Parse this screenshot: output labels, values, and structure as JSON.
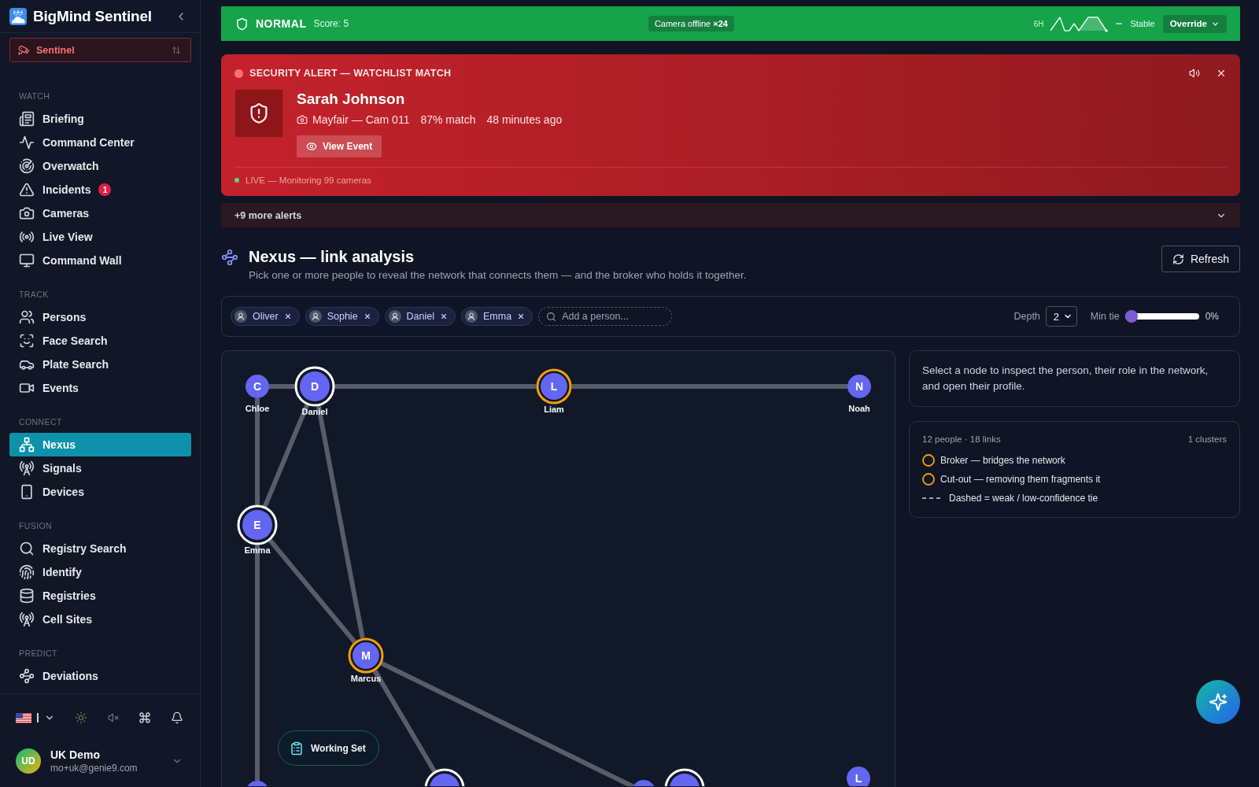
{
  "sidebar": {
    "brand": "BigMind Sentinel",
    "mode": "Sentinel",
    "sections": [
      {
        "title": "WATCH",
        "items": [
          {
            "label": "Briefing",
            "selected": false
          },
          {
            "label": "Command Center",
            "selected": false
          },
          {
            "label": "Overwatch",
            "selected": false
          },
          {
            "label": "Incidents",
            "selected": false,
            "badge": "1"
          },
          {
            "label": "Cameras",
            "selected": false
          },
          {
            "label": "Live View",
            "selected": false
          },
          {
            "label": "Command Wall",
            "selected": false
          }
        ]
      },
      {
        "title": "TRACK",
        "items": [
          {
            "label": "Persons",
            "selected": false
          },
          {
            "label": "Face Search",
            "selected": false
          },
          {
            "label": "Plate Search",
            "selected": false
          },
          {
            "label": "Events",
            "selected": false
          }
        ]
      },
      {
        "title": "CONNECT",
        "items": [
          {
            "label": "Nexus",
            "selected": true
          },
          {
            "label": "Signals",
            "selected": false
          },
          {
            "label": "Devices",
            "selected": false
          }
        ]
      },
      {
        "title": "FUSION",
        "items": [
          {
            "label": "Registry Search",
            "selected": false
          },
          {
            "label": "Identify",
            "selected": false
          },
          {
            "label": "Registries",
            "selected": false
          },
          {
            "label": "Cell Sites",
            "selected": false
          }
        ]
      },
      {
        "title": "PREDICT",
        "items": [
          {
            "label": "Deviations",
            "selected": false
          }
        ]
      }
    ],
    "user": {
      "initials": "UD",
      "name": "UK Demo",
      "email": "mo+uk@genie9.com"
    }
  },
  "status_bar": {
    "kind": "normal",
    "state_label": "NORMAL",
    "score": "Score: 5",
    "notice": "Camera offline **×24**",
    "range": "6H",
    "trend": "Stable",
    "override": "Override"
  },
  "alert": {
    "title": "SECURITY ALERT — WATCHLIST MATCH",
    "name": "Sarah Johnson",
    "location": "Mayfair — Cam 011",
    "match": "87% match",
    "time": "48 minutes ago",
    "action": "View Event",
    "live": "LIVE — Monitoring 99 cameras",
    "more": "+9 more alerts"
  },
  "nexus": {
    "title": "Nexus — link analysis",
    "subtitle": "Pick one or more people to reveal the network that connects them — and the broker who holds it together.",
    "refresh": "Refresh",
    "chips": [
      "Oliver",
      "Sophie",
      "Daniel",
      "Emma"
    ],
    "add_person": {
      "placeholder": "Add a person..."
    },
    "depth": {
      "label": "Depth",
      "value": "2"
    },
    "min_tie": {
      "label": "Min tie",
      "level": 0,
      "reading": "0%"
    }
  },
  "graph": {
    "nodes": [
      {
        "initial": "C",
        "name": "Chloe",
        "selected": false,
        "broker": false
      },
      {
        "initial": "D",
        "name": "Daniel",
        "selected": true,
        "broker": false
      },
      {
        "initial": "L",
        "name": "Liam",
        "selected": false,
        "broker": true
      },
      {
        "initial": "N",
        "name": "Noah",
        "selected": false,
        "broker": false
      },
      {
        "initial": "E",
        "name": "Emma",
        "selected": true,
        "broker": false
      },
      {
        "initial": "M",
        "name": "Marcus",
        "selected": false,
        "broker": true
      },
      {
        "initial": "L",
        "selected": false,
        "broker": false
      },
      {
        "selected": false,
        "broker": false
      },
      {
        "selected": true,
        "broker": false
      },
      {
        "selected": false,
        "broker": false
      },
      {
        "selected": true,
        "broker": false
      }
    ],
    "working_set": "Working Set"
  },
  "inspector": {
    "hint": "Select a node to inspect the person, their role in the network, and open their profile."
  },
  "stats": {
    "summary": "12 people · 18 links",
    "clusters": "1 clusters",
    "legend": [
      {
        "kind": "ring",
        "label": "Broker — bridges the network"
      },
      {
        "kind": "ring",
        "label": "Cut-out — removing them fragments it"
      },
      {
        "kind": "dash",
        "label": "Dashed = weak / low-confidence tie"
      }
    ]
  }
}
